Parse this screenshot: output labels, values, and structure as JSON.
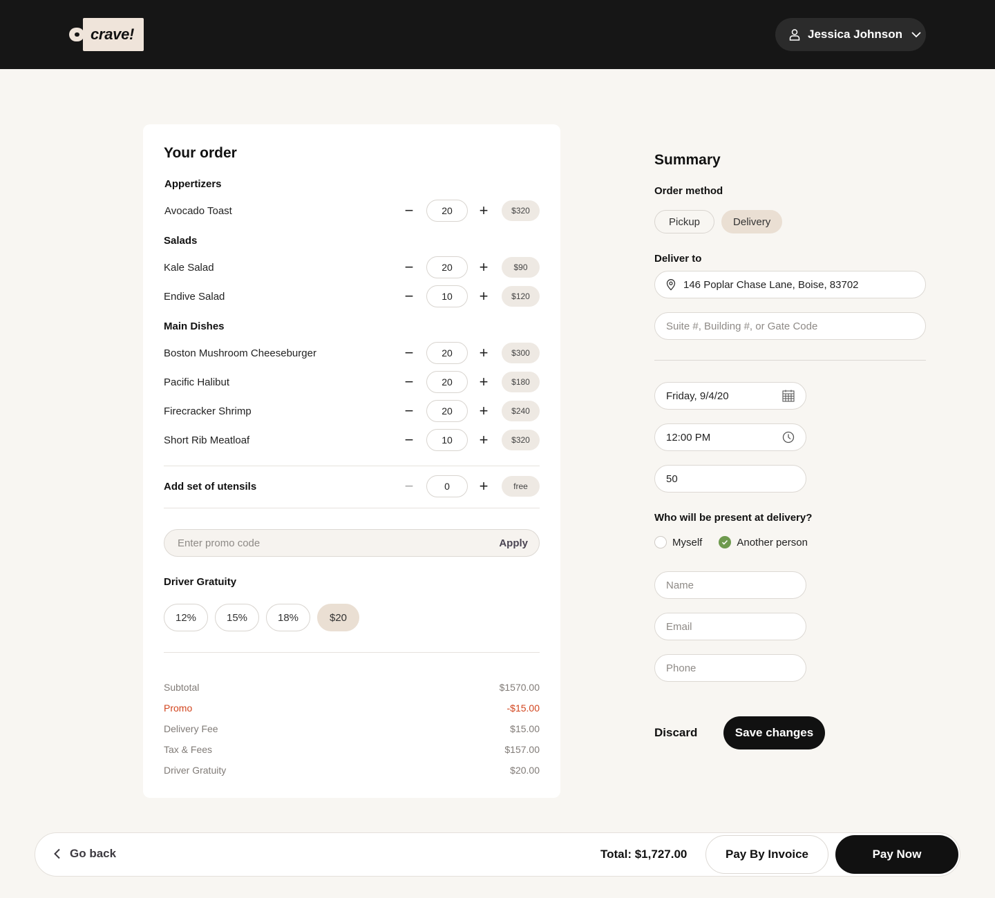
{
  "header": {
    "logo_text": "crave!",
    "user_name": "Jessica Johnson"
  },
  "order": {
    "title": "Your order",
    "categories": [
      {
        "name": "Appertizers",
        "items": [
          {
            "name": "Avocado Toast",
            "qty": "20",
            "price": "$320"
          }
        ]
      },
      {
        "name": "Salads",
        "items": [
          {
            "name": "Kale Salad",
            "qty": "20",
            "price": "$90"
          },
          {
            "name": "Endive Salad",
            "qty": "10",
            "price": "$120"
          }
        ]
      },
      {
        "name": "Main Dishes",
        "items": [
          {
            "name": "Boston Mushroom Cheeseburger",
            "qty": "20",
            "price": "$300"
          },
          {
            "name": "Pacific Halibut",
            "qty": "20",
            "price": "$180"
          },
          {
            "name": "Firecracker Shrimp",
            "qty": "20",
            "price": "$240"
          },
          {
            "name": "Short Rib Meatloaf",
            "qty": "10",
            "price": "$320"
          }
        ]
      }
    ],
    "utensils": {
      "label": "Add set of utensils",
      "qty": "0",
      "price": "free"
    },
    "promo": {
      "placeholder": "Enter promo code",
      "apply_label": "Apply"
    },
    "gratuity": {
      "title": "Driver Gratuity",
      "options": [
        "12%",
        "15%",
        "18%",
        "$20"
      ],
      "selected": "$20"
    },
    "totals": [
      {
        "label": "Subtotal",
        "value": "$1570.00"
      },
      {
        "label": "Promo",
        "value": "-$15.00"
      },
      {
        "label": "Delivery Fee",
        "value": "$15.00"
      },
      {
        "label": "Tax & Fees",
        "value": "$157.00"
      },
      {
        "label": "Driver Gratuity",
        "value": "$20.00"
      }
    ]
  },
  "summary": {
    "title": "Summary",
    "order_method_label": "Order method",
    "methods": [
      "Pickup",
      "Delivery"
    ],
    "selected_method": "Delivery",
    "deliver_to_label": "Deliver to",
    "address": "146  Poplar Chase Lane,  Boise, 83702",
    "suite_placeholder": "Suite #, Building #, or Gate Code",
    "date": "Friday, 9/4/20",
    "time": "12:00 PM",
    "headcount": "50",
    "present_label": "Who will be present at delivery?",
    "present_options": [
      "Myself",
      "Another person"
    ],
    "present_selected": "Another person",
    "name_placeholder": "Name",
    "email_placeholder": "Email",
    "phone_placeholder": "Phone",
    "discard_label": "Discard",
    "save_label": "Save changes"
  },
  "footer": {
    "go_back_label": "Go back",
    "total_label": "Total: $1,727.00",
    "invoice_label": "Pay By Invoice",
    "pay_now_label": "Pay Now"
  },
  "colors": {
    "header_bg": "#161616",
    "page_bg": "#f8f6f2",
    "accent_chip": "#eadfd3",
    "promo_red": "#d2451e",
    "check_green": "#6e9a4e"
  }
}
